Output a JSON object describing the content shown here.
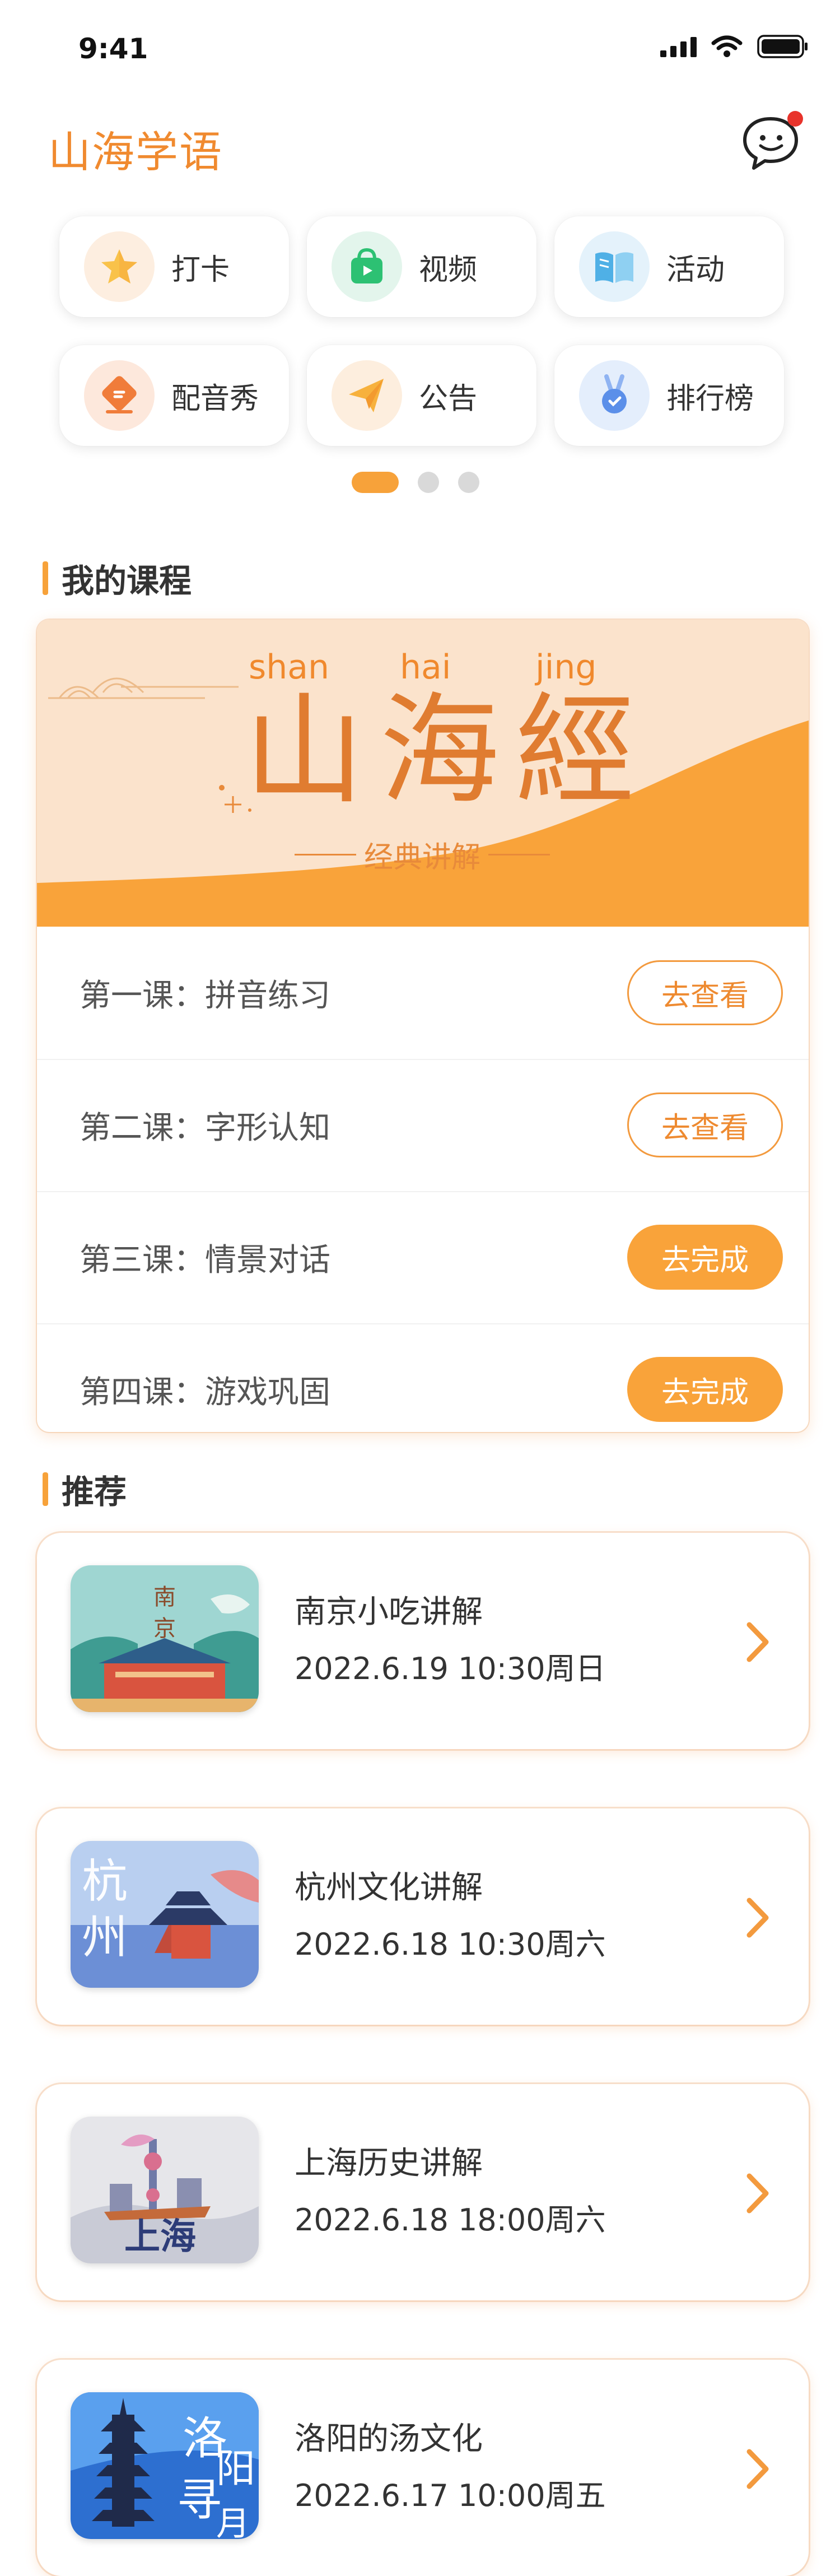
{
  "status": {
    "time": "9:41"
  },
  "header": {
    "title": "山海学语"
  },
  "quick_menu": [
    {
      "label": "打卡",
      "icon": "star-icon",
      "bg": "#fdeee0",
      "color": "#f9c24a"
    },
    {
      "label": "视频",
      "icon": "video-bag-icon",
      "bg": "#e3f5ec",
      "color": "#2dc173"
    },
    {
      "label": "活动",
      "icon": "book-icon",
      "bg": "#e4f2fb",
      "color": "#4fb0e6"
    },
    {
      "label": "配音秀",
      "icon": "dubbing-icon",
      "bg": "#fde8dc",
      "color": "#f07c3a"
    },
    {
      "label": "公告",
      "icon": "paper-plane-icon",
      "bg": "#fdeede",
      "color": "#f7b13d"
    },
    {
      "label": "排行榜",
      "icon": "medal-icon",
      "bg": "#e4eefc",
      "color": "#5b8fe9"
    }
  ],
  "my_courses": {
    "title": "我的课程",
    "banner": {
      "pinyin": [
        "shan",
        "hai",
        "jing"
      ],
      "title": "山海經",
      "subtitle": "经典讲解"
    },
    "lessons": [
      {
        "name": "第一课：拼音练习",
        "action": "去查看",
        "style": "outline"
      },
      {
        "name": "第二课：字形认知",
        "action": "去查看",
        "style": "outline"
      },
      {
        "name": "第三课：情景对话",
        "action": "去完成",
        "style": "fill"
      },
      {
        "name": "第四课：游戏巩固",
        "action": "去完成",
        "style": "fill"
      }
    ]
  },
  "recommend": {
    "title": "推荐",
    "items": [
      {
        "title": "南京小吃讲解",
        "date": "2022.6.19 10:30周日",
        "thumb_text": "南京"
      },
      {
        "title": "杭州文化讲解",
        "date": "2022.6.18 10:30周六",
        "thumb_text": "杭州"
      },
      {
        "title": "上海历史讲解",
        "date": "2022.6.18 18:00周六",
        "thumb_text": "上海"
      },
      {
        "title": "洛阳的汤文化",
        "date": "2022.6.17 10:00周五",
        "thumb_text": "洛阳寻月"
      }
    ]
  },
  "colors": {
    "accent": "#f9a33a",
    "title": "#f08a2f"
  }
}
